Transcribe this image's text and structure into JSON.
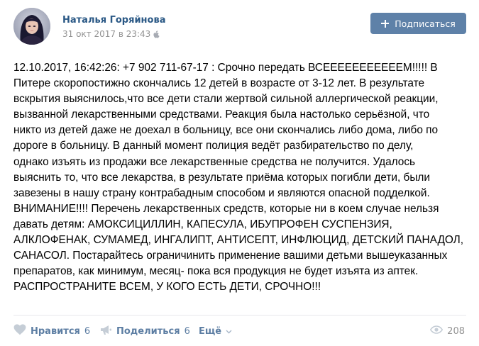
{
  "author": {
    "name": "Наталья Горяйнова",
    "date": "31 окт 2017 в 23:43",
    "platform_icon": "apple-icon"
  },
  "subscribe_button": {
    "label": "Подписаться",
    "icon": "plus-icon",
    "color": "#5e81a8"
  },
  "post": {
    "text_lines": [
      "12.10.2017, 16:42:26: +7 902 711-67-17 : Срочно передать ВСЕЕЕЕЕЕЕЕЕЕЕМ!!!!! В",
      "Питере скоропостижно скончались 12 детей в возрасте от 3-12 лет. В результате",
      "вскрытия выяснилось,что все дети стали жертвой сильной аллергической реакции,",
      "вызванной лекарственными средствами. Реакция была настолько серьёзной, что",
      "никто из детей даже не доехал в больницу, все они скончались либо дома, либо по",
      "дороге в больницу. В данный момент полиция ведёт разбирательство по делу,",
      "однако изъять из продажи все лекарственные средства не получится. Удалось",
      "выяснить то, что все лекарства, в результате приёма которых погибли дети, были",
      "завезены в нашу страну контрабадным способом и являются опасной подделкой.",
      "ВНИМАНИЕ!!!! Перечень лекарственных средств, которые ни в коем случае нельзя",
      "давать детям: АМОКСИЦИЛЛИН, КАПЕСУЛА, ИБУПРОФЕН СУСПЕНЗИЯ,",
      "АЛКЛОФЕНАК, СУМАМЕД, ИНГАЛИПТ, АНТИСЕПТ, ИНФЛЮЦИД, ДЕТСКИЙ ПАНАДОЛ,",
      "САНАСОЛ. Постарайтесь ограничинить применение вашими детьми вышеуказанных",
      "препаратов, как минимум, месяц- пока вся продукция не будет изъята из аптек.",
      "РАСПРОСТРАНИТЕ ВСЕМ, У КОГО ЕСТЬ ДЕТИ, СРОЧНО!!!"
    ]
  },
  "footer": {
    "like": {
      "label": "Нравится",
      "count": "6",
      "icon": "heart-icon"
    },
    "share": {
      "label": "Поделиться",
      "count": "6",
      "icon": "megaphone-icon"
    },
    "more": {
      "label": "Ещё",
      "icon": "chevron-down-icon"
    },
    "views": {
      "count": "208",
      "icon": "eye-icon"
    }
  },
  "colors": {
    "link": "#2a5885",
    "action": "#5d7ea3",
    "muted": "#939393",
    "divider": "#e7e8ec"
  }
}
